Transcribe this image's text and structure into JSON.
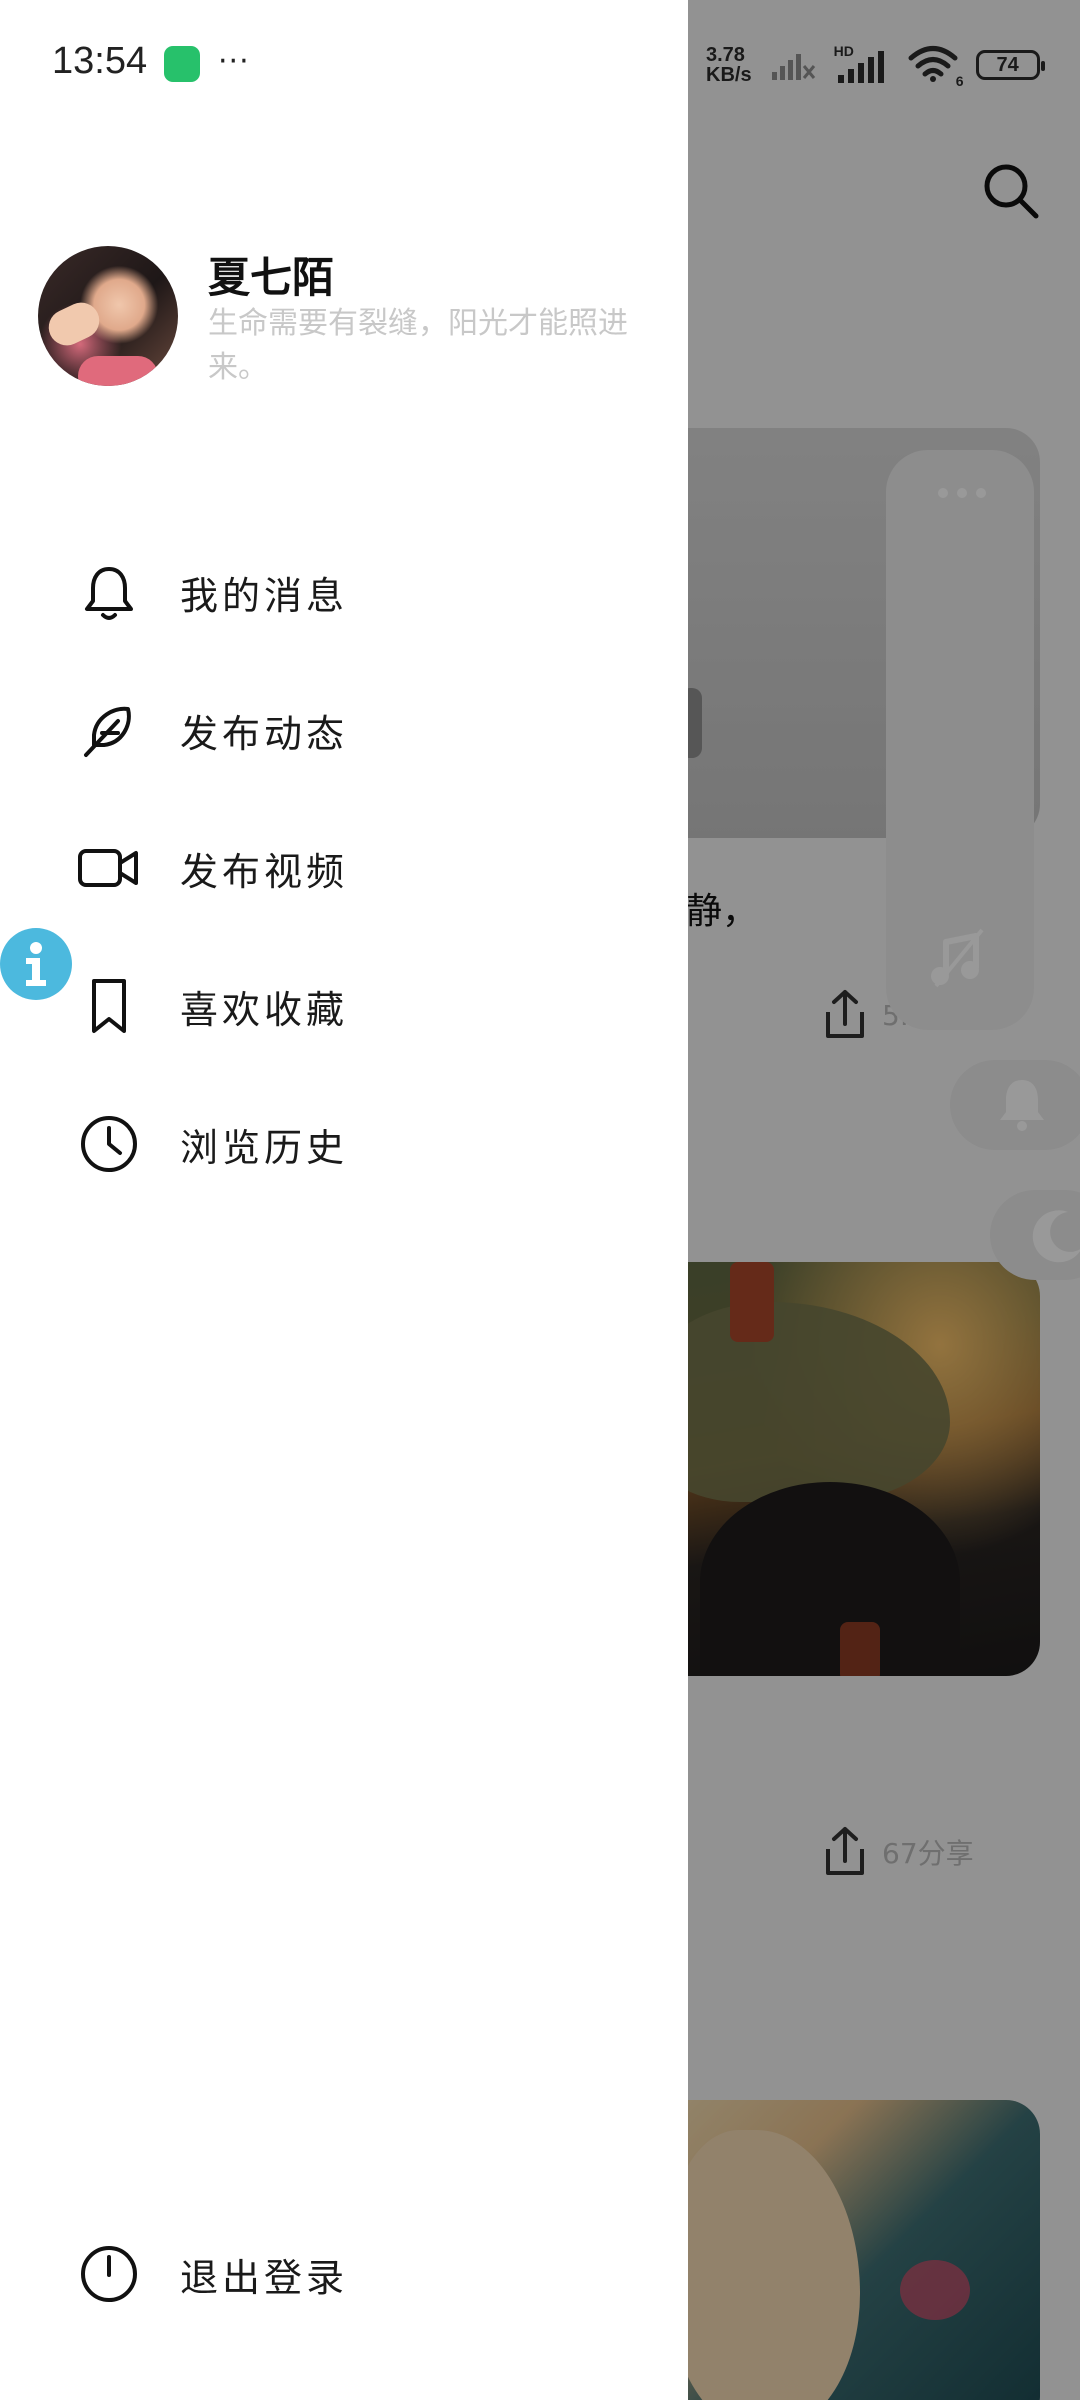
{
  "status_bar": {
    "time": "13:54",
    "more": "···",
    "net_speed_value": "3.78",
    "net_speed_unit": "KB/s",
    "hd_label": "HD",
    "battery": "74",
    "wifi_badge": "6"
  },
  "drawer": {
    "user_name": "夏七陌",
    "user_bio": "生命需要有裂缝，阳光才能照进来。",
    "menu": {
      "messages": "我的消息",
      "post": "发布动态",
      "video": "发布视频",
      "favorites": "喜欢收藏",
      "history": "浏览历史"
    },
    "logout": "退出登录"
  },
  "background": {
    "partial_text": "静，",
    "share_count_1": "5...",
    "share_count_2": "67分享"
  },
  "icons": {
    "search": "search-icon",
    "bell": "bell-icon",
    "feather": "feather-icon",
    "video": "video-camera-icon",
    "bookmark": "bookmark-icon",
    "clock": "clock-icon",
    "power": "power-icon",
    "info": "info-icon",
    "music": "music-off-icon",
    "moon": "moon-icon"
  },
  "colors": {
    "drawer_bg": "#ffffff",
    "overlay": "rgba(0,0,0,0.40)",
    "bio_text": "#c8c8c8",
    "info_badge": "#4cb9de",
    "app_badge": "#27c16b"
  }
}
